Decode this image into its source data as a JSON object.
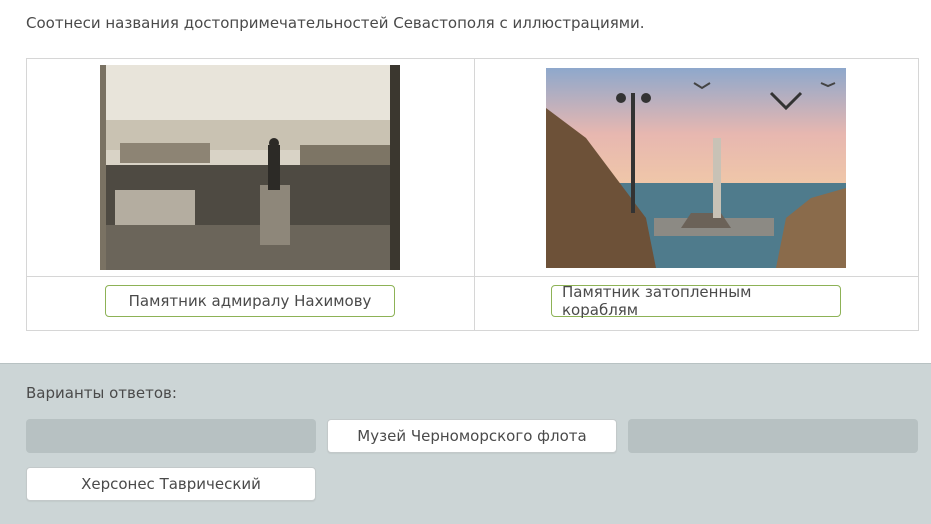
{
  "question": "Соотнеси названия достопримечательностей Севастополя с иллюстрациями.",
  "matches": [
    {
      "image": "photo-nakhimov-monument",
      "placed_answer": "Памятник адмиралу Нахимову"
    },
    {
      "image": "photo-sunken-ships-monument",
      "placed_answer": "Памятник затопленным кораблям"
    }
  ],
  "answers": {
    "title": "Варианты ответов:",
    "options": [
      {
        "label": ""
      },
      {
        "label": "Музей Черноморского флота"
      },
      {
        "label": ""
      },
      {
        "label": "Херсонес Таврический"
      }
    ]
  },
  "colors": {
    "accent_border": "#8db256",
    "answers_bg": "#ccd5d6",
    "empty_slot": "#b7c1c2"
  }
}
